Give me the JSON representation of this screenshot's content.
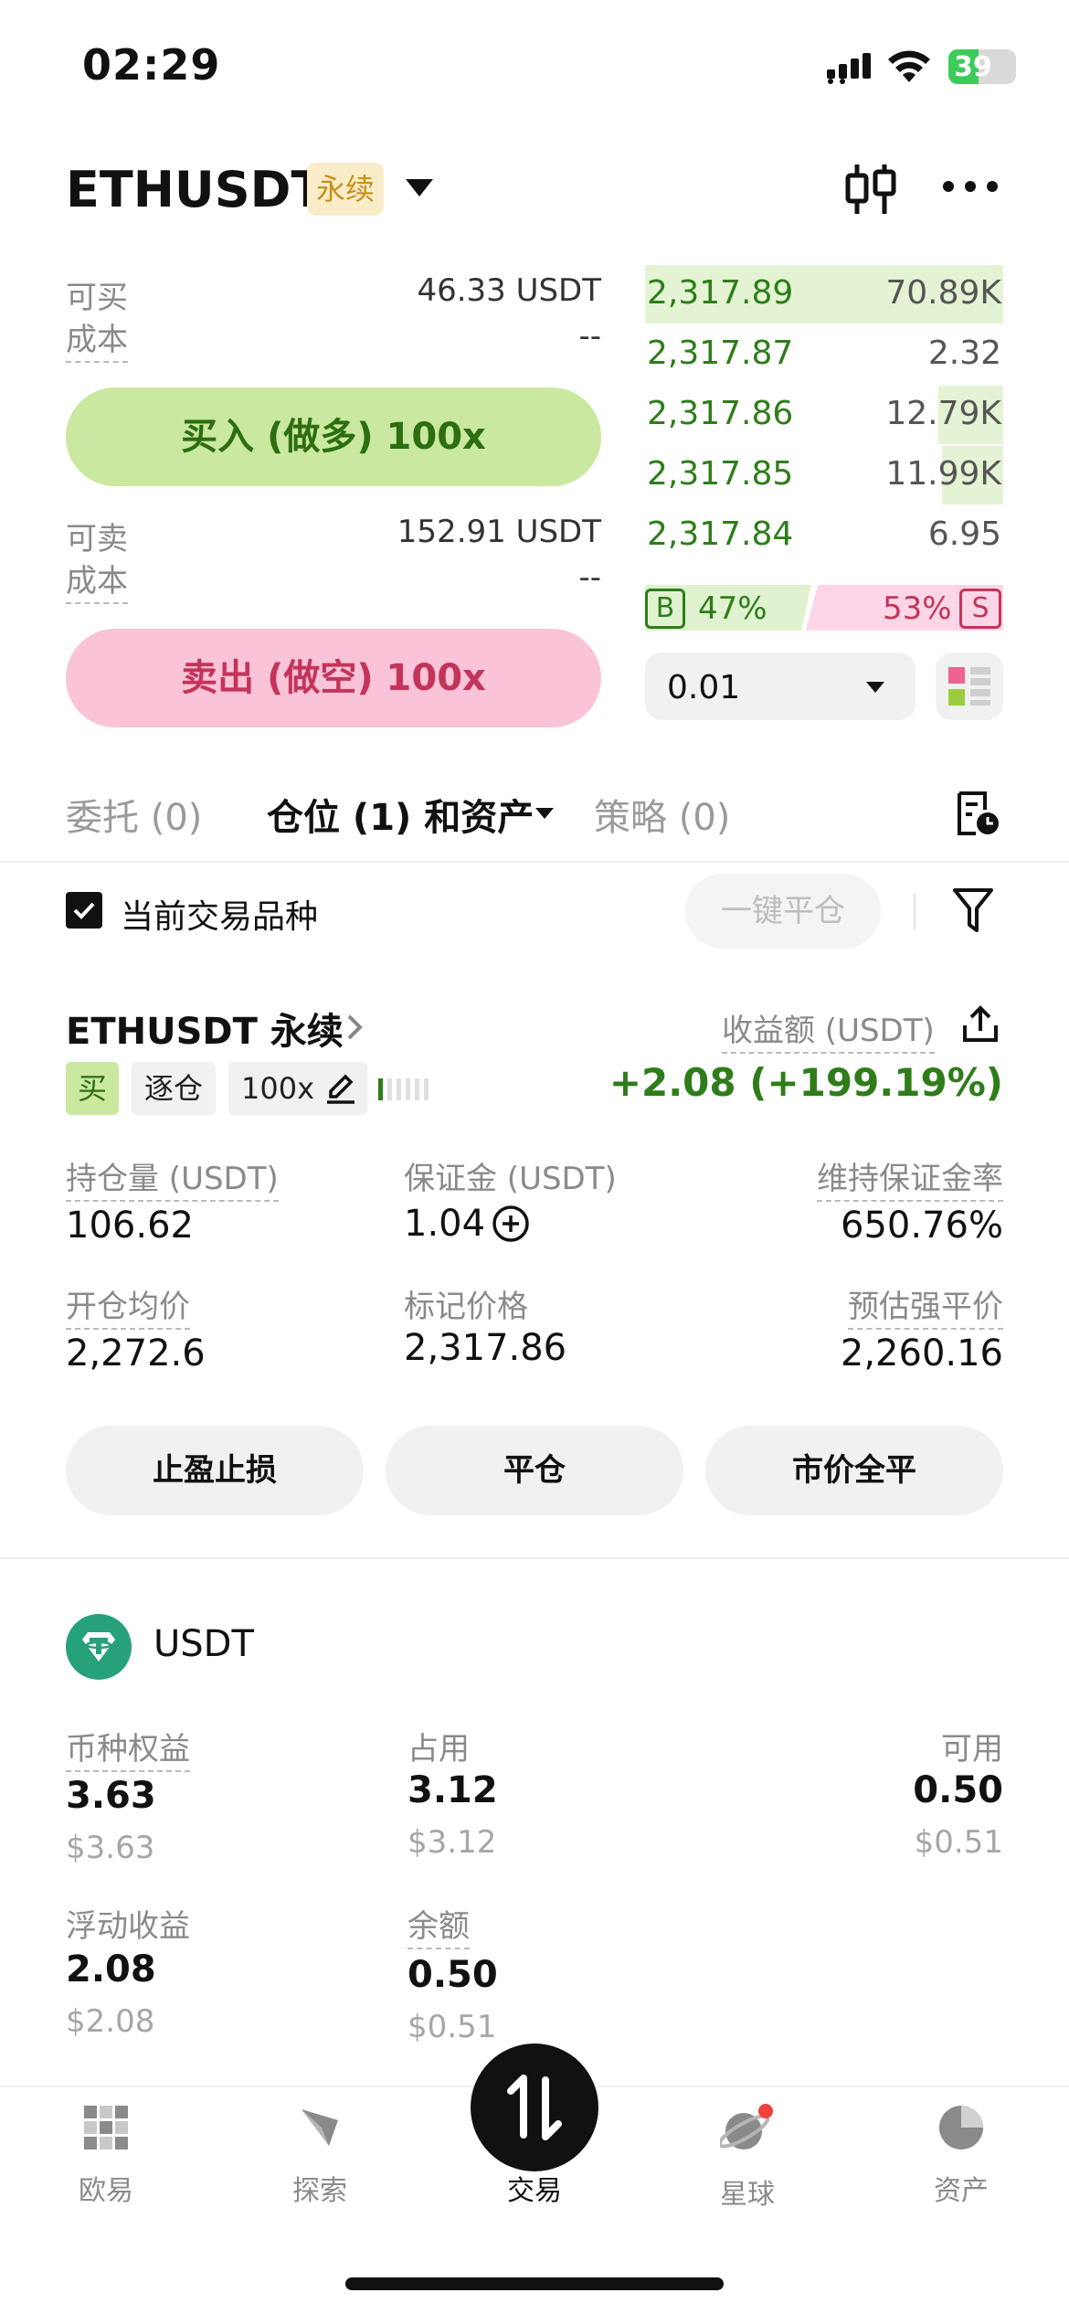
{
  "status_bar": {
    "time": "02:29",
    "battery": "39"
  },
  "header": {
    "pair": "ETHUSDT",
    "contract_tag": "永续"
  },
  "trade_panel": {
    "buy": {
      "avail_label": "可买",
      "avail_value": "46.33 USDT",
      "cost_label": "成本",
      "cost_value": "--",
      "button_label": "买入 (做多) 100x"
    },
    "sell": {
      "avail_label": "可卖",
      "avail_value": "152.91 USDT",
      "cost_label": "成本",
      "cost_value": "--",
      "button_label": "卖出 (做空) 100x"
    }
  },
  "order_book": {
    "rows": [
      {
        "price": "2,317.89",
        "qty": "70.89K",
        "depth": 1.0
      },
      {
        "price": "2,317.87",
        "qty": "2.32",
        "depth": 0.0
      },
      {
        "price": "2,317.86",
        "qty": "12.79K",
        "depth": 0.18
      },
      {
        "price": "2,317.85",
        "qty": "11.99K",
        "depth": 0.17
      },
      {
        "price": "2,317.84",
        "qty": "6.95",
        "depth": 0.0
      }
    ],
    "b_label": "B",
    "b_pct": "47%",
    "s_pct": "53%",
    "s_label": "S",
    "qty_step": "0.01"
  },
  "tabs": {
    "orders": "委托 (0)",
    "positions": "仓位 (1) 和资产",
    "strategies": "策略 (0)"
  },
  "filter": {
    "current_only": "当前交易品种",
    "close_all": "一键平仓"
  },
  "position": {
    "title": "ETHUSDT 永续",
    "side": "买",
    "margin_mode": "逐仓",
    "leverage": "100x",
    "pnl_label": "收益额 (USDT)",
    "pnl_value": "+2.08 (+199.19%)",
    "size_label": "持仓量 (USDT)",
    "size_value": "106.62",
    "margin_label": "保证金 (USDT)",
    "margin_value": "1.04",
    "mmr_label": "维持保证金率",
    "mmr_value": "650.76%",
    "entry_label": "开仓均价",
    "entry_value": "2,272.6",
    "mark_label": "标记价格",
    "mark_value": "2,317.86",
    "liq_label": "预估强平价",
    "liq_value": "2,260.16",
    "btn_tpsl": "止盈止损",
    "btn_close": "平仓",
    "btn_market_close": "市价全平"
  },
  "asset": {
    "name": "USDT",
    "equity_label": "币种权益",
    "equity_value": "3.63",
    "equity_usd": "$3.63",
    "used_label": "占用",
    "used_value": "3.12",
    "used_usd": "$3.12",
    "avail_label": "可用",
    "avail_value": "0.50",
    "avail_usd": "$0.51",
    "float_label": "浮动收益",
    "float_value": "2.08",
    "float_usd": "$2.08",
    "balance_label": "余额",
    "balance_value": "0.50",
    "balance_usd": "$0.51"
  },
  "nav": {
    "home": "欧易",
    "explore": "探索",
    "trade": "交易",
    "planet": "星球",
    "assets": "资产"
  },
  "colors": {
    "buy_green": "#2f7d1a",
    "buy_bg": "#cbe8a0",
    "sell_red": "#c4345a",
    "sell_bg": "#fbc3d7",
    "tether": "#26a17b"
  }
}
